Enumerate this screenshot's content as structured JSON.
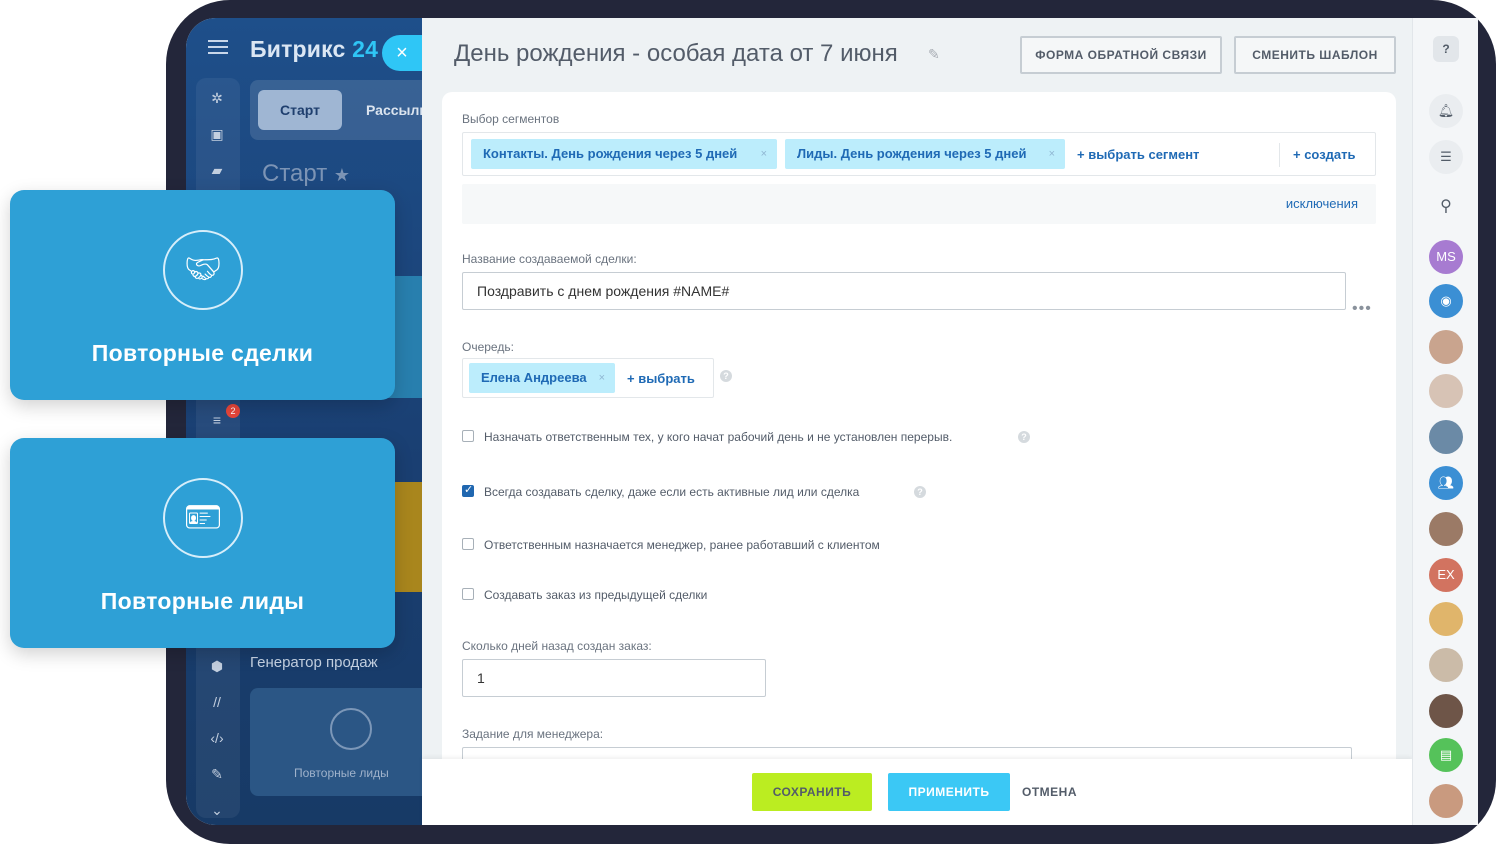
{
  "sidebar": {
    "logo_main": "Битрикс",
    "logo_suffix": "24",
    "close": "×",
    "tab_active": "Старт",
    "tab_other": "Рассылк",
    "start_title": "Старт",
    "generator": "Генератор продаж",
    "mini_card_label": "Повторные лиды",
    "badge": "2"
  },
  "panel": {
    "title": "День рождения - особая дата от 7 июня",
    "btn_feedback": "ФОРМА ОБРАТНОЙ СВЯЗИ",
    "btn_template": "СМЕНИТЬ ШАБЛОН"
  },
  "segments": {
    "label": "Выбор сегментов",
    "tags": [
      "Контакты. День рождения через 5 дней",
      "Лиды. День рождения через 5 дней"
    ],
    "select_link": "+ выбрать сегмент",
    "create_link": "+ создать",
    "exclusions": "исключения"
  },
  "deal_name": {
    "label": "Название создаваемой сделки:",
    "value": "Поздравить с днем рождения #NAME#"
  },
  "queue": {
    "label": "Очередь:",
    "tag": "Елена Андреева",
    "select_link": "+ выбрать"
  },
  "options": [
    {
      "label": "Назначать ответственным тех, у кого начат рабочий день и не установлен перерыв.",
      "checked": false
    },
    {
      "label": "Всегда создавать сделку, даже если есть активные лид или сделка",
      "checked": true
    },
    {
      "label": "Ответственным назначается менеджер, ранее работавший с клиентом",
      "checked": false
    },
    {
      "label": "Создавать заказ из предыдущей сделки",
      "checked": false
    }
  ],
  "days_ago": {
    "label": "Сколько дней назад создан заказ:",
    "value": "1"
  },
  "task": {
    "label": "Задание для менеджера:"
  },
  "footer": {
    "save": "СОХРАНИТЬ",
    "apply": "ПРИМЕНИТЬ",
    "cancel": "ОТМЕНА"
  },
  "right_bar": {
    "help": "?",
    "avatar_ms": "MS",
    "avatar_ex": "EX"
  },
  "promos": [
    {
      "label": "Повторные сделки",
      "icon": "handshake-icon"
    },
    {
      "label": "Повторные лиды",
      "icon": "contact-card-icon"
    }
  ],
  "colors": {
    "accent_blue": "#2ea0d6",
    "save_green": "#bbed21",
    "apply_cyan": "#3bc8f5",
    "link_blue": "#1f6ab5"
  }
}
